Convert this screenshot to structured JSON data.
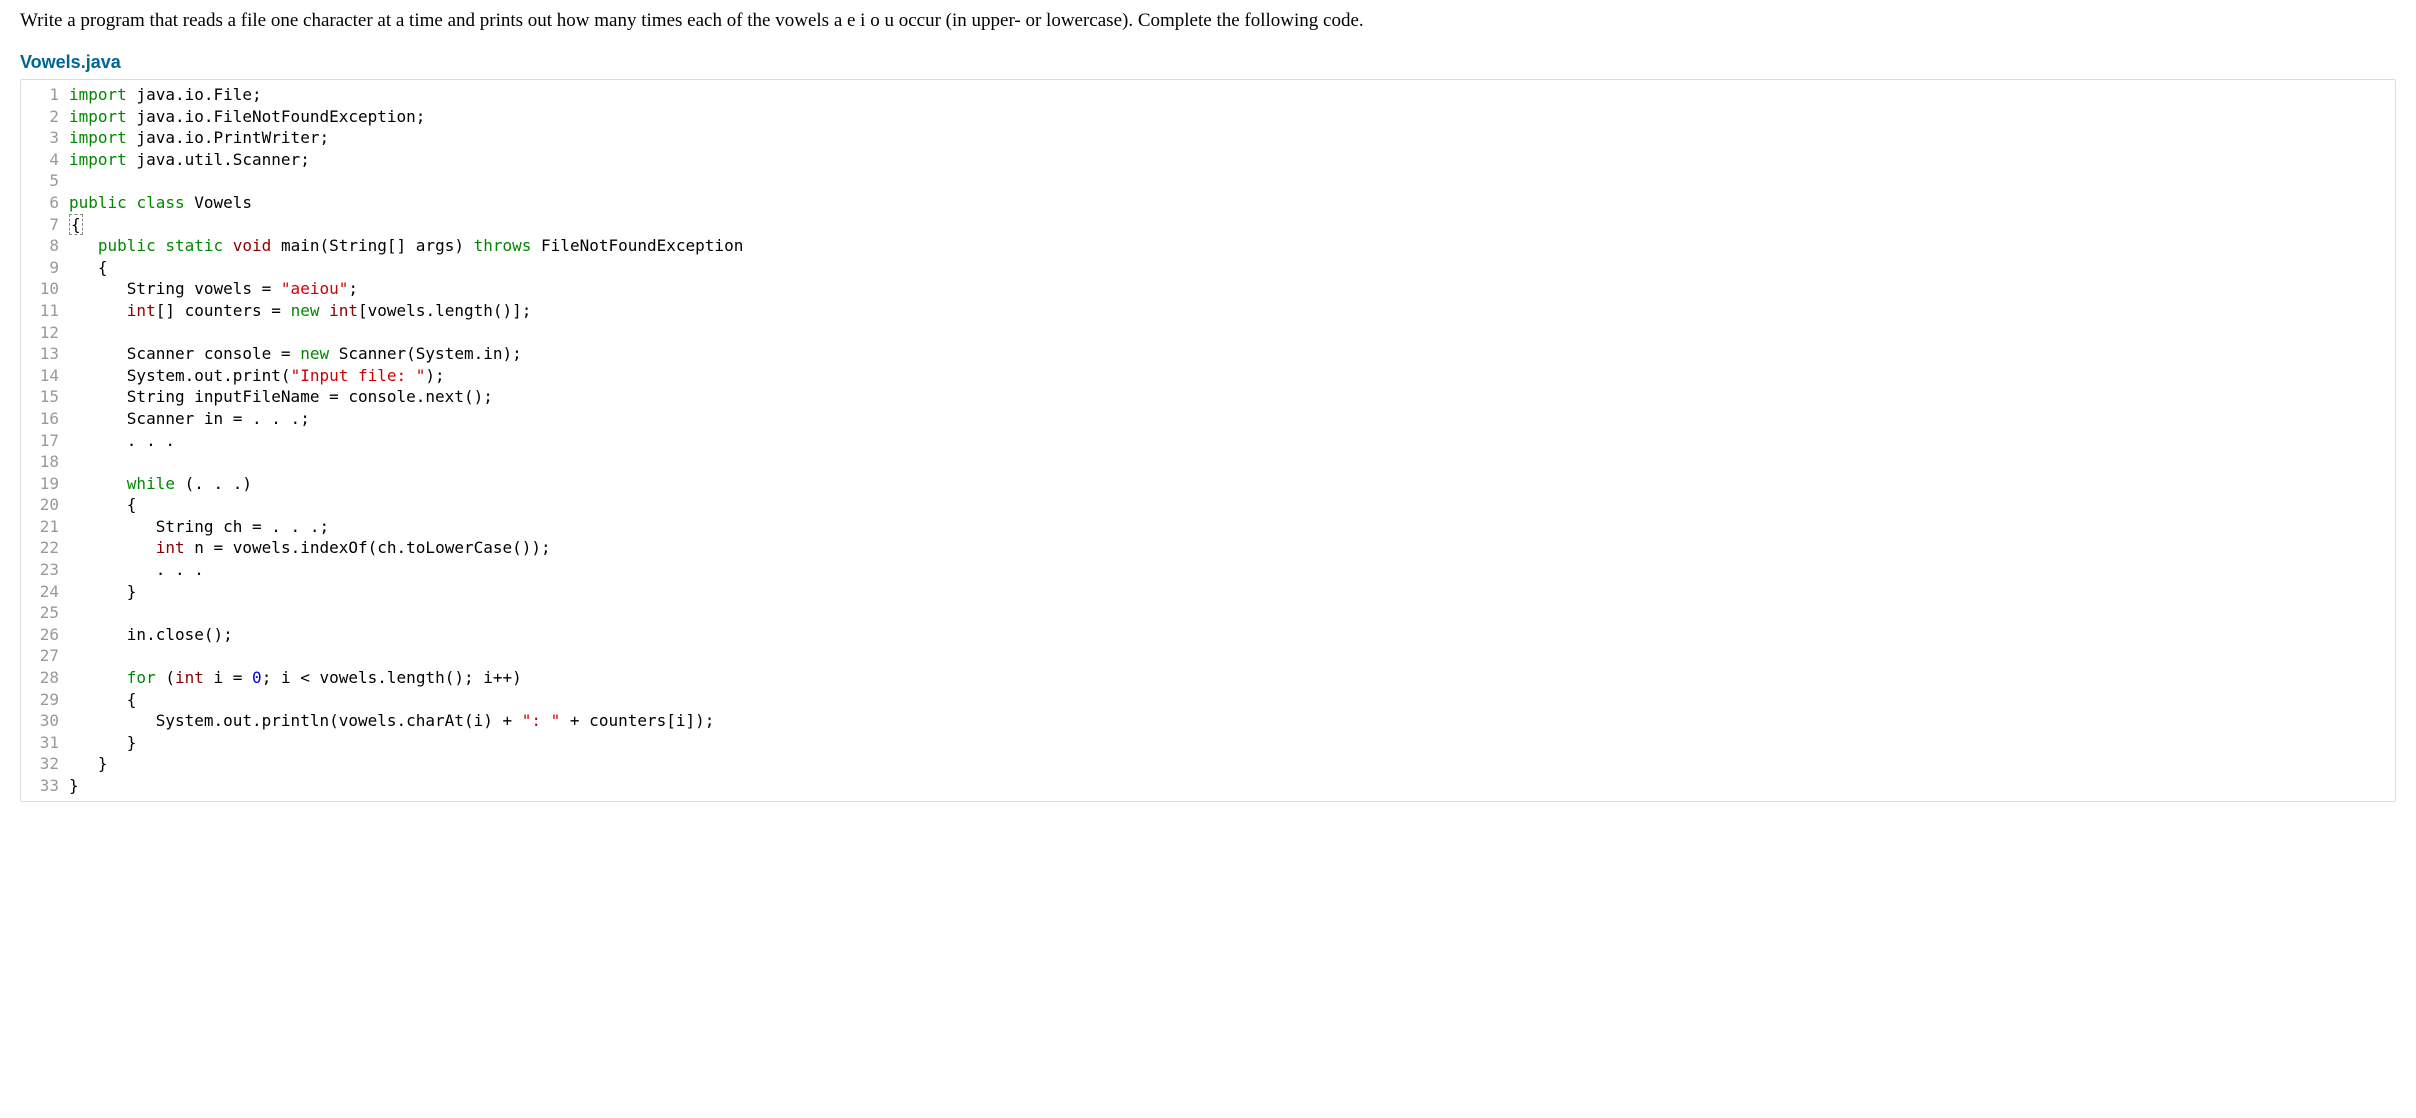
{
  "problem_statement": "Write a program that reads a file one character at a time and prints out how many times each of the vowels a e i o u occur (in upper- or lowercase). Complete the following code.",
  "filename": "Vowels.java",
  "code": {
    "lines": [
      {
        "n": 1,
        "tokens": [
          [
            "kw-import",
            "import"
          ],
          [
            "",
            " java.io.File;"
          ]
        ]
      },
      {
        "n": 2,
        "tokens": [
          [
            "kw-import",
            "import"
          ],
          [
            "",
            " java.io.FileNotFoundException;"
          ]
        ]
      },
      {
        "n": 3,
        "tokens": [
          [
            "kw-import",
            "import"
          ],
          [
            "",
            " java.io.PrintWriter;"
          ]
        ]
      },
      {
        "n": 4,
        "tokens": [
          [
            "kw-import",
            "import"
          ],
          [
            "",
            " java.util.Scanner;"
          ]
        ]
      },
      {
        "n": 5,
        "tokens": [
          [
            "",
            ""
          ]
        ]
      },
      {
        "n": 6,
        "tokens": [
          [
            "kw-public",
            "public"
          ],
          [
            "",
            " "
          ],
          [
            "kw-class",
            "class"
          ],
          [
            "",
            " Vowels"
          ]
        ]
      },
      {
        "n": 7,
        "tokens": [
          [
            "caret-brace",
            "{"
          ]
        ]
      },
      {
        "n": 8,
        "tokens": [
          [
            "",
            "   "
          ],
          [
            "kw-public",
            "public"
          ],
          [
            "",
            " "
          ],
          [
            "kw-static",
            "static"
          ],
          [
            "",
            " "
          ],
          [
            "kw-void",
            "void"
          ],
          [
            "",
            " main(String[] args) "
          ],
          [
            "kw-throws",
            "throws"
          ],
          [
            "",
            " FileNotFoundException"
          ]
        ]
      },
      {
        "n": 9,
        "tokens": [
          [
            "",
            "   {"
          ]
        ]
      },
      {
        "n": 10,
        "tokens": [
          [
            "",
            "      String vowels = "
          ],
          [
            "str",
            "\"aeiou\""
          ],
          [
            "",
            ";"
          ]
        ]
      },
      {
        "n": 11,
        "tokens": [
          [
            "",
            "      "
          ],
          [
            "kw-int",
            "int"
          ],
          [
            "",
            "[] counters = "
          ],
          [
            "kw-new",
            "new"
          ],
          [
            "",
            " "
          ],
          [
            "kw-int",
            "int"
          ],
          [
            "",
            "[vowels.length()];"
          ]
        ]
      },
      {
        "n": 12,
        "tokens": [
          [
            "",
            ""
          ]
        ]
      },
      {
        "n": 13,
        "tokens": [
          [
            "",
            "      Scanner console = "
          ],
          [
            "kw-new",
            "new"
          ],
          [
            "",
            " Scanner(System.in);"
          ]
        ]
      },
      {
        "n": 14,
        "tokens": [
          [
            "",
            "      System.out.print("
          ],
          [
            "str",
            "\"Input file: \""
          ],
          [
            "",
            ");"
          ]
        ]
      },
      {
        "n": 15,
        "tokens": [
          [
            "",
            "      String inputFileName = console.next();"
          ]
        ]
      },
      {
        "n": 16,
        "tokens": [
          [
            "",
            "      Scanner in = . . .;"
          ]
        ]
      },
      {
        "n": 17,
        "tokens": [
          [
            "",
            "      . . ."
          ]
        ]
      },
      {
        "n": 18,
        "tokens": [
          [
            "",
            ""
          ]
        ]
      },
      {
        "n": 19,
        "tokens": [
          [
            "",
            "      "
          ],
          [
            "kw-while",
            "while"
          ],
          [
            "",
            " (. . .)"
          ]
        ]
      },
      {
        "n": 20,
        "tokens": [
          [
            "",
            "      {"
          ]
        ]
      },
      {
        "n": 21,
        "tokens": [
          [
            "",
            "         String ch = . . .;"
          ]
        ]
      },
      {
        "n": 22,
        "tokens": [
          [
            "",
            "         "
          ],
          [
            "kw-int",
            "int"
          ],
          [
            "",
            " n = vowels.indexOf(ch.toLowerCase());"
          ]
        ]
      },
      {
        "n": 23,
        "tokens": [
          [
            "",
            "         . . ."
          ]
        ]
      },
      {
        "n": 24,
        "tokens": [
          [
            "",
            "      }"
          ]
        ]
      },
      {
        "n": 25,
        "tokens": [
          [
            "",
            ""
          ]
        ]
      },
      {
        "n": 26,
        "tokens": [
          [
            "",
            "      in.close();"
          ]
        ]
      },
      {
        "n": 27,
        "tokens": [
          [
            "",
            ""
          ]
        ]
      },
      {
        "n": 28,
        "tokens": [
          [
            "",
            "      "
          ],
          [
            "kw-for",
            "for"
          ],
          [
            "",
            " ("
          ],
          [
            "kw-int",
            "int"
          ],
          [
            "",
            " i = "
          ],
          [
            "num",
            "0"
          ],
          [
            "",
            "; i < vowels.length(); i++)"
          ]
        ]
      },
      {
        "n": 29,
        "tokens": [
          [
            "",
            "      {"
          ]
        ]
      },
      {
        "n": 30,
        "tokens": [
          [
            "",
            "         System.out.println(vowels.charAt(i) + "
          ],
          [
            "str",
            "\": \""
          ],
          [
            "",
            " + counters[i]);"
          ]
        ]
      },
      {
        "n": 31,
        "tokens": [
          [
            "",
            "      }"
          ]
        ]
      },
      {
        "n": 32,
        "tokens": [
          [
            "",
            "   }"
          ]
        ]
      },
      {
        "n": 33,
        "tokens": [
          [
            "",
            "}"
          ]
        ]
      }
    ]
  }
}
